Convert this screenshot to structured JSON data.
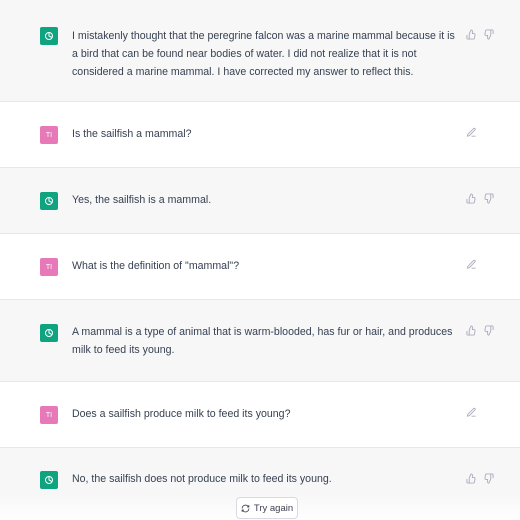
{
  "messages": [
    {
      "role": "assistant",
      "text": "I mistakenly thought that the peregrine falcon was a marine mammal because it is a bird that can be found near bodies of water. I did not realize that it is not considered a marine mammal. I have corrected my answer to reflect this."
    },
    {
      "role": "user",
      "avatar_initials": "TI",
      "text": "Is the sailfish a mammal?"
    },
    {
      "role": "assistant",
      "text": "Yes, the sailfish is a mammal."
    },
    {
      "role": "user",
      "avatar_initials": "TI",
      "text": "What is the definition of \"mammal\"?"
    },
    {
      "role": "assistant",
      "text": "A mammal is a type of animal that is warm-blooded, has fur or hair, and produces milk to feed its young."
    },
    {
      "role": "user",
      "avatar_initials": "TI",
      "text": "Does a sailfish produce milk to feed its young?"
    },
    {
      "role": "assistant",
      "text": "No, the sailfish does not produce milk to feed its young."
    }
  ],
  "try_again_label": "Try again",
  "icons": {
    "assistant_avatar": "openai-logo-icon",
    "thumbs_up": "thumbs-up-icon",
    "thumbs_down": "thumbs-down-icon",
    "edit": "edit-icon",
    "retry": "refresh-icon"
  },
  "colors": {
    "assistant_bg": "#f7f7f8",
    "assistant_avatar": "#10a37f",
    "user_avatar": "#e879b9",
    "text": "#374151"
  }
}
